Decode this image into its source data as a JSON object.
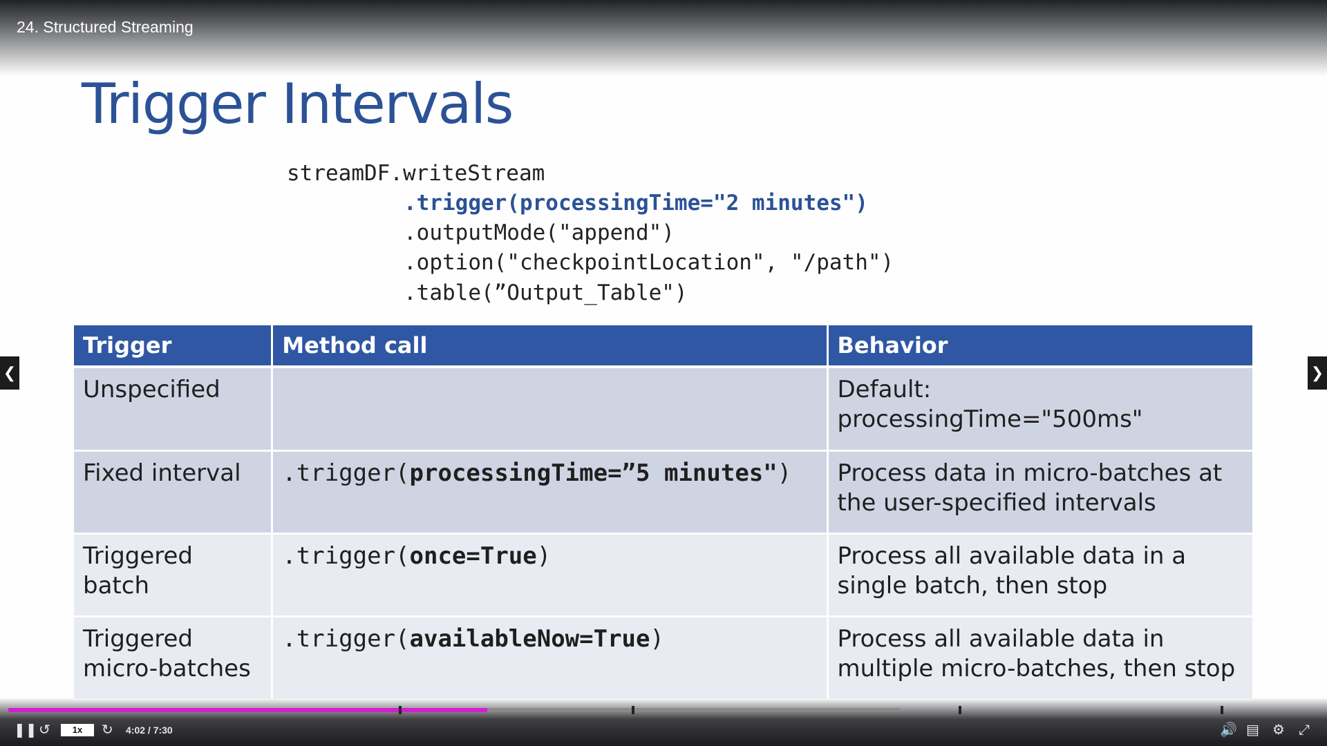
{
  "player": {
    "lecture_title": "24. Structured Streaming",
    "speed": "1x",
    "time": "4:02 / 7:30",
    "progress_fraction": 0.537,
    "icons": [
      "pause-icon",
      "rewind-icon",
      "forward-icon",
      "volume-icon",
      "captions-icon",
      "settings-icon",
      "exit-fullscreen-icon",
      "prev-arrow-icon",
      "next-arrow-icon"
    ],
    "accent_color": "#d61cd0"
  },
  "slide": {
    "title": "Trigger Intervals",
    "code": {
      "line1": "streamDF.writeStream",
      "line2": ".trigger(processingTime=\"2 minutes\")",
      "line3": ".outputMode(\"append\")",
      "line4": ".option(\"checkpointLocation\", \"/path\")",
      "line5": ".table(”Output_Table\")"
    },
    "table": {
      "headers": [
        "Trigger",
        "Method call",
        "Behavior"
      ],
      "rows": [
        {
          "trigger": "Unspecified",
          "method_prefix": "",
          "method_arg": "",
          "method_suffix": "",
          "behavior": "Default: processingTime=\"500ms\""
        },
        {
          "trigger": "Fixed interval",
          "method_prefix": ".trigger(",
          "method_arg": "processingTime=”5 minutes\"",
          "method_suffix": ")",
          "behavior": "Process data in micro-batches at the user-specified intervals"
        },
        {
          "trigger": "Triggered batch",
          "method_prefix": ".trigger(",
          "method_arg": "once=True",
          "method_suffix": ")",
          "behavior": "Process all available data in a single batch, then stop"
        },
        {
          "trigger": "Triggered micro-batches",
          "method_prefix": ".trigger(",
          "method_arg": "availableNow=True",
          "method_suffix": ")",
          "behavior": "Process all available data in multiple micro-batches, then stop"
        }
      ],
      "header_color": "#2f57a3"
    }
  }
}
